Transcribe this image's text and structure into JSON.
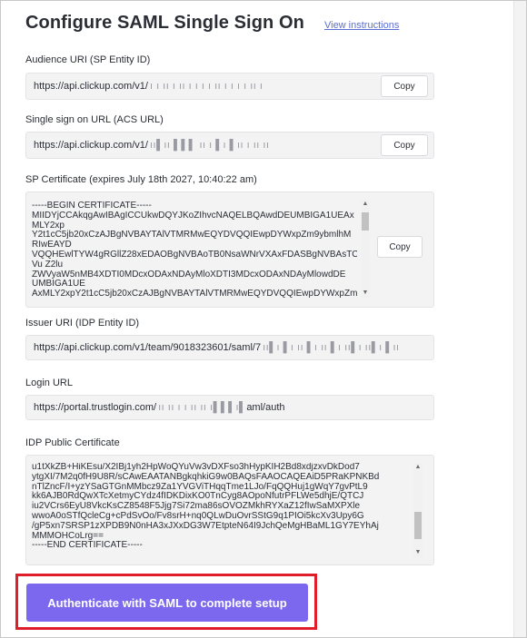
{
  "header": {
    "title": "Configure SAML Single Sign On",
    "view_instructions": "View instructions"
  },
  "audience": {
    "label": "Audience URI (SP Entity ID)",
    "value": "https://api.clickup.com/v1/",
    "redacted": "ı ı ıı ı ıı ı ı ı ı ıı ı ı ı ı ıı ı",
    "copy": "Copy"
  },
  "acs": {
    "label": "Single sign on URL (ACS URL)",
    "value": "https://api.clickup.com/v1/",
    "redacted": "ıı▌ıı ▌▌▌ ıı ı ▌ı ▌ıı ı ıı ıı",
    "copy": "Copy"
  },
  "sp_certificate": {
    "label": "SP Certificate (expires July 18th 2027, 10:40:22 am)",
    "lines": [
      "-----BEGIN CERTIFICATE-----",
      "MIIDYjCCAkqgAwIBAgICCUkwDQYJKoZIhvcNAQELBQAwdDEUMBIGA1UEAx",
      "MLY2xp",
      "Y2t1cC5jb20xCzAJBgNVBAYTAlVTMRMwEQYDVQQIEwpDYWxpZm9ybmlhM",
      "RIwEAYD",
      "VQQHEwlTYW4gRGllZ28xEDAOBgNVBAoTB0NsaWNrVXAxFDASBgNVBAsTC0",
      "Vu Z2lu",
      "ZWVyaW5nMB4XDTI0MDcxODAxNDAyMloXDTI3MDcxODAxNDAyMlowdDE",
      "UMBIGA1UE",
      "AxMLY2xpY2t1cC5jb20xCzAJBgNVBAYTAlVTMRMwEQYDVQQIEwpDYWxpZm"
    ],
    "copy": "Copy"
  },
  "issuer": {
    "label": "Issuer URI (IDP Entity ID)",
    "value": "https://api.clickup.com/v1/team/9018323601/saml/7",
    "redacted": "ıı▌ı ▌ı ıı ▌ı ıı ▌ı ıı▌ı ıı▌ı ▌ıı"
  },
  "login": {
    "label": "Login URL",
    "value_prefix": "https://portal.trustlogin.com/",
    "redacted": "ıı ıı ı ı ıı ıı ı▌▌▌ı▌",
    "value_suffix": "aml/auth"
  },
  "idp_certificate": {
    "label": "IDP Public Certificate",
    "lines": [
      "u1tXkZB+HiKEsu/X2IBj1yh2HpWoQYuVw3vDXFso3hHypKIH2Bd8xdjzxvDkDod7",
      "ytgXI/7M2q0fH9U8R/sCAwEAATANBgkqhkiG9w0BAQsFAAOCAQEAiD5PRaKPNKBd",
      "nTlZncF/I+yzYSaGTGnMMbcz9Za1YVGViTHqqTme1LJo/FqQQHuj1gWqY7gvPtL9",
      "kk6AJB0RdQwXTcXetmyCYdz4fIDKDixKO0TnCyg8AOpoNfutrPFLWe5dhjE/QTCJ",
      "iu2VCrs6EyU8VkcKsCZ8548F5Jjg7Si72ma86sOVOZMkhRYXaZ12fIwSaMXPXle",
      "wwoA0oSTfQcleCg+cPdSvOo/Fv8srH+nq0QLwDuOvrSStG9q1PIOi5kcXv3Upy6G",
      "/gP5xn7SRSP1zXPDB9N0nHA3xJXxDG3W7EtpteN64I9JchQeMgHBaML1GY7EYhAj",
      "MMMOHCoLrg==",
      "-----END CERTIFICATE-----"
    ]
  },
  "auth_button": {
    "label": "Authenticate with SAML to complete setup"
  },
  "colors": {
    "accent": "#7b68ee",
    "highlight_border": "#e01e2b",
    "link": "#5a6ed4"
  }
}
